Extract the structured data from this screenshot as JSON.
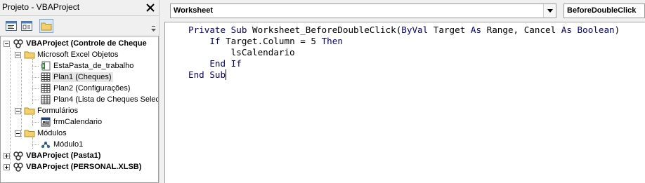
{
  "project_explorer": {
    "title": "Projeto - VBAProject",
    "close_icon": "close-icon",
    "toolbar": {
      "view_code_icon": "view-code-icon",
      "view_object_icon": "view-object-icon",
      "toggle_folders_icon": "folder-icon"
    },
    "tree": {
      "projects": [
        {
          "name": "VBAProject (Controle de Cheque",
          "expanded": true,
          "folders": [
            {
              "name": "Microsoft Excel Objetos",
              "items": [
                {
                  "label": "EstaPasta_de_trabalho",
                  "icon": "workbook-icon"
                },
                {
                  "label": "Plan1 (Cheques)",
                  "icon": "sheet-icon",
                  "selected": true
                },
                {
                  "label": "Plan2 (Configurações)",
                  "icon": "sheet-icon"
                },
                {
                  "label": "Plan4 (Lista de Cheques Selec",
                  "icon": "sheet-icon"
                }
              ]
            },
            {
              "name": "Formulários",
              "items": [
                {
                  "label": "frmCalendario",
                  "icon": "form-icon"
                }
              ]
            },
            {
              "name": "Módulos",
              "items": [
                {
                  "label": "Módulo1",
                  "icon": "module-icon"
                }
              ]
            }
          ]
        },
        {
          "name": "VBAProject (Pasta1)",
          "expanded": false
        },
        {
          "name": "VBAProject (PERSONAL.XLSB)",
          "expanded": false
        }
      ]
    }
  },
  "code_window": {
    "object_selector": {
      "value": "Worksheet"
    },
    "procedure_selector": {
      "value": "BeforeDoubleClick"
    },
    "code_lines": [
      [
        {
          "t": "Private Sub",
          "kw": true
        },
        {
          "t": " Worksheet_BeforeDoubleClick("
        },
        {
          "t": "ByVal",
          "kw": true
        },
        {
          "t": " Target "
        },
        {
          "t": "As",
          "kw": true
        },
        {
          "t": " Range, Cancel "
        },
        {
          "t": "As Boolean",
          "kw": true
        },
        {
          "t": ")"
        }
      ],
      [
        {
          "t": "    "
        },
        {
          "t": "If",
          "kw": true
        },
        {
          "t": " Target.Column = 5 "
        },
        {
          "t": "Then",
          "kw": true
        }
      ],
      [
        {
          "t": "        lsCalendario"
        }
      ],
      [
        {
          "t": "    "
        },
        {
          "t": "End If",
          "kw": true
        }
      ],
      [
        {
          "t": "End Sub",
          "kw": true
        }
      ]
    ]
  },
  "colors": {
    "keyword": "#00007f",
    "text": "#000000"
  }
}
